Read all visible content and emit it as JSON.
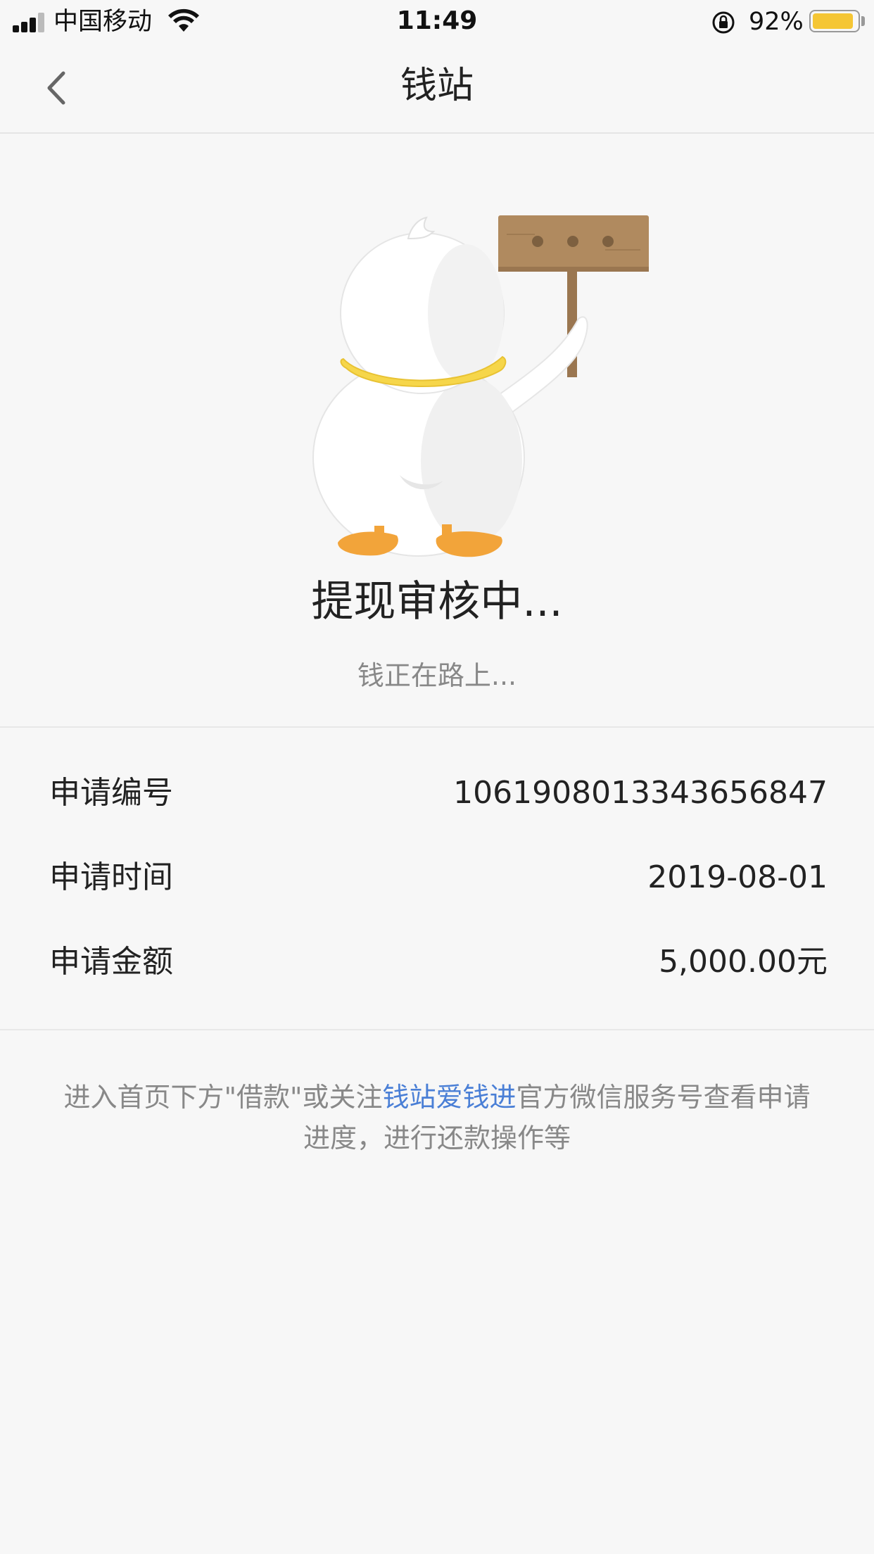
{
  "status_bar": {
    "carrier": "中国移动",
    "time": "11:49",
    "battery_percent": "92%",
    "battery_level": 0.92,
    "battery_color": "#f5c634"
  },
  "nav": {
    "title": "钱站",
    "back_icon": "chevron-left-icon"
  },
  "status": {
    "title": "提现审核中...",
    "subtitle": "钱正在路上..."
  },
  "info": {
    "rows": [
      {
        "label": "申请编号",
        "value": "1061908013343656847"
      },
      {
        "label": "申请时间",
        "value": "2019-08-01"
      },
      {
        "label": "申请金额",
        "value": "5,000.00元"
      }
    ]
  },
  "footer": {
    "text_before": "进入首页下方\"借款\"或关注",
    "link_text": "钱站爱钱进",
    "text_after": "官方微信服务号查看申请进度，进行还款操作等",
    "link_color": "#4a7fd6"
  }
}
